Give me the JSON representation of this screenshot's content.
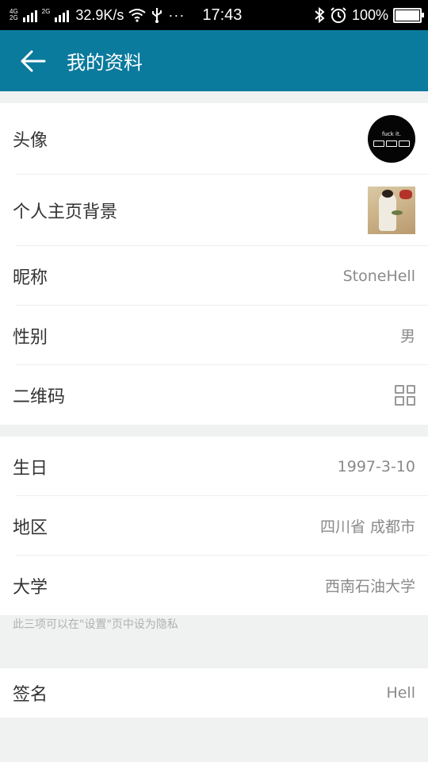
{
  "status_bar": {
    "network_top": "4G",
    "network_bottom": "2G",
    "network2": "2G",
    "speed": "32.9K/s",
    "time": "17:43",
    "dots": "···",
    "battery": "100%",
    "battery_level": 1.0
  },
  "header": {
    "title": "我的资料",
    "back_icon": "arrow-left-icon"
  },
  "profile": {
    "avatar_label": "头像",
    "avatar_text": "fuck it.",
    "background_label": "个人主页背景",
    "nickname_label": "昵称",
    "nickname_value": "StoneHell",
    "gender_label": "性别",
    "gender_value": "男",
    "qrcode_label": "二维码",
    "qrcode_icon": "qrcode-icon"
  },
  "details": {
    "birthday_label": "生日",
    "birthday_value": "1997-3-10",
    "region_label": "地区",
    "region_value": "四川省 成都市",
    "university_label": "大学",
    "university_value": "西南石油大学"
  },
  "privacy_hint": "此三项可以在\"设置\"页中设为隐私",
  "signature": {
    "label": "签名",
    "value": "Hell"
  },
  "colors": {
    "header_bg": "#0a7a9d",
    "page_bg": "#eff2f1"
  }
}
